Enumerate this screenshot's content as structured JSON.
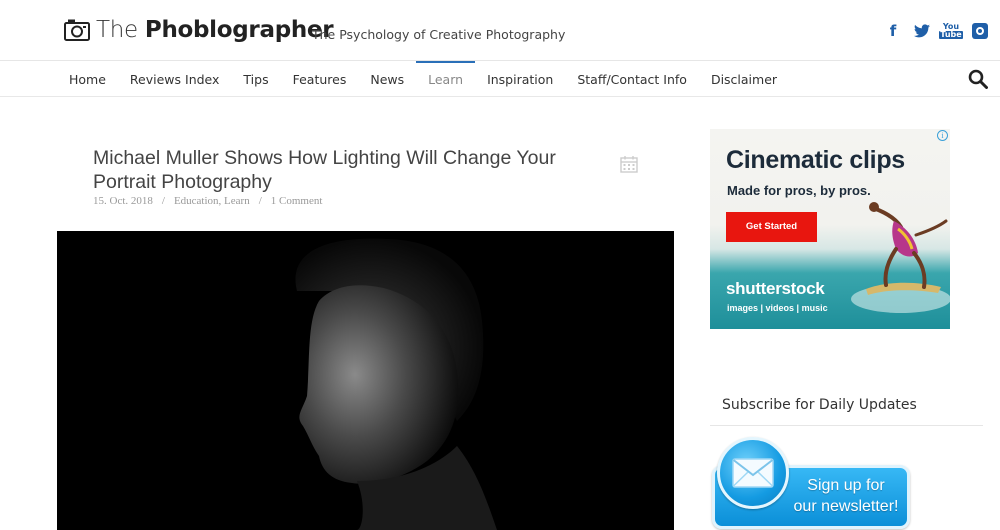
{
  "site": {
    "name_light": "The ",
    "name_bold": "Phoblographer",
    "tagline": "The Psychology of Creative Photography"
  },
  "social": {
    "facebook": "f",
    "youtube_top": "You",
    "youtube_bottom": "Tube"
  },
  "nav": {
    "items": [
      {
        "label": "Home"
      },
      {
        "label": "Reviews Index"
      },
      {
        "label": "Tips"
      },
      {
        "label": "Features"
      },
      {
        "label": "News"
      },
      {
        "label": "Learn"
      },
      {
        "label": "Inspiration"
      },
      {
        "label": "Staff/Contact Info"
      },
      {
        "label": "Disclaimer"
      }
    ],
    "active": "Learn"
  },
  "article": {
    "title": "Michael Muller Shows How Lighting Will Change Your Portrait Photography",
    "date": "15. Oct. 2018",
    "categories": "Education, Learn",
    "comments": "1 Comment",
    "separator": "/"
  },
  "ad": {
    "info": "i",
    "headline": "Cinematic clips",
    "subheadline": "Made for pros, by pros.",
    "cta": "Get Started",
    "brand": "shutterstock",
    "categories": "images  |  videos  |  music"
  },
  "sidebar": {
    "subscribe_title": "Subscribe for Daily Updates",
    "newsletter_line1": "Sign up for",
    "newsletter_line2": "our newsletter!"
  },
  "colors": {
    "accent": "#2a6fb8",
    "social": "#1f5fa8",
    "cta": "#e8160f"
  }
}
